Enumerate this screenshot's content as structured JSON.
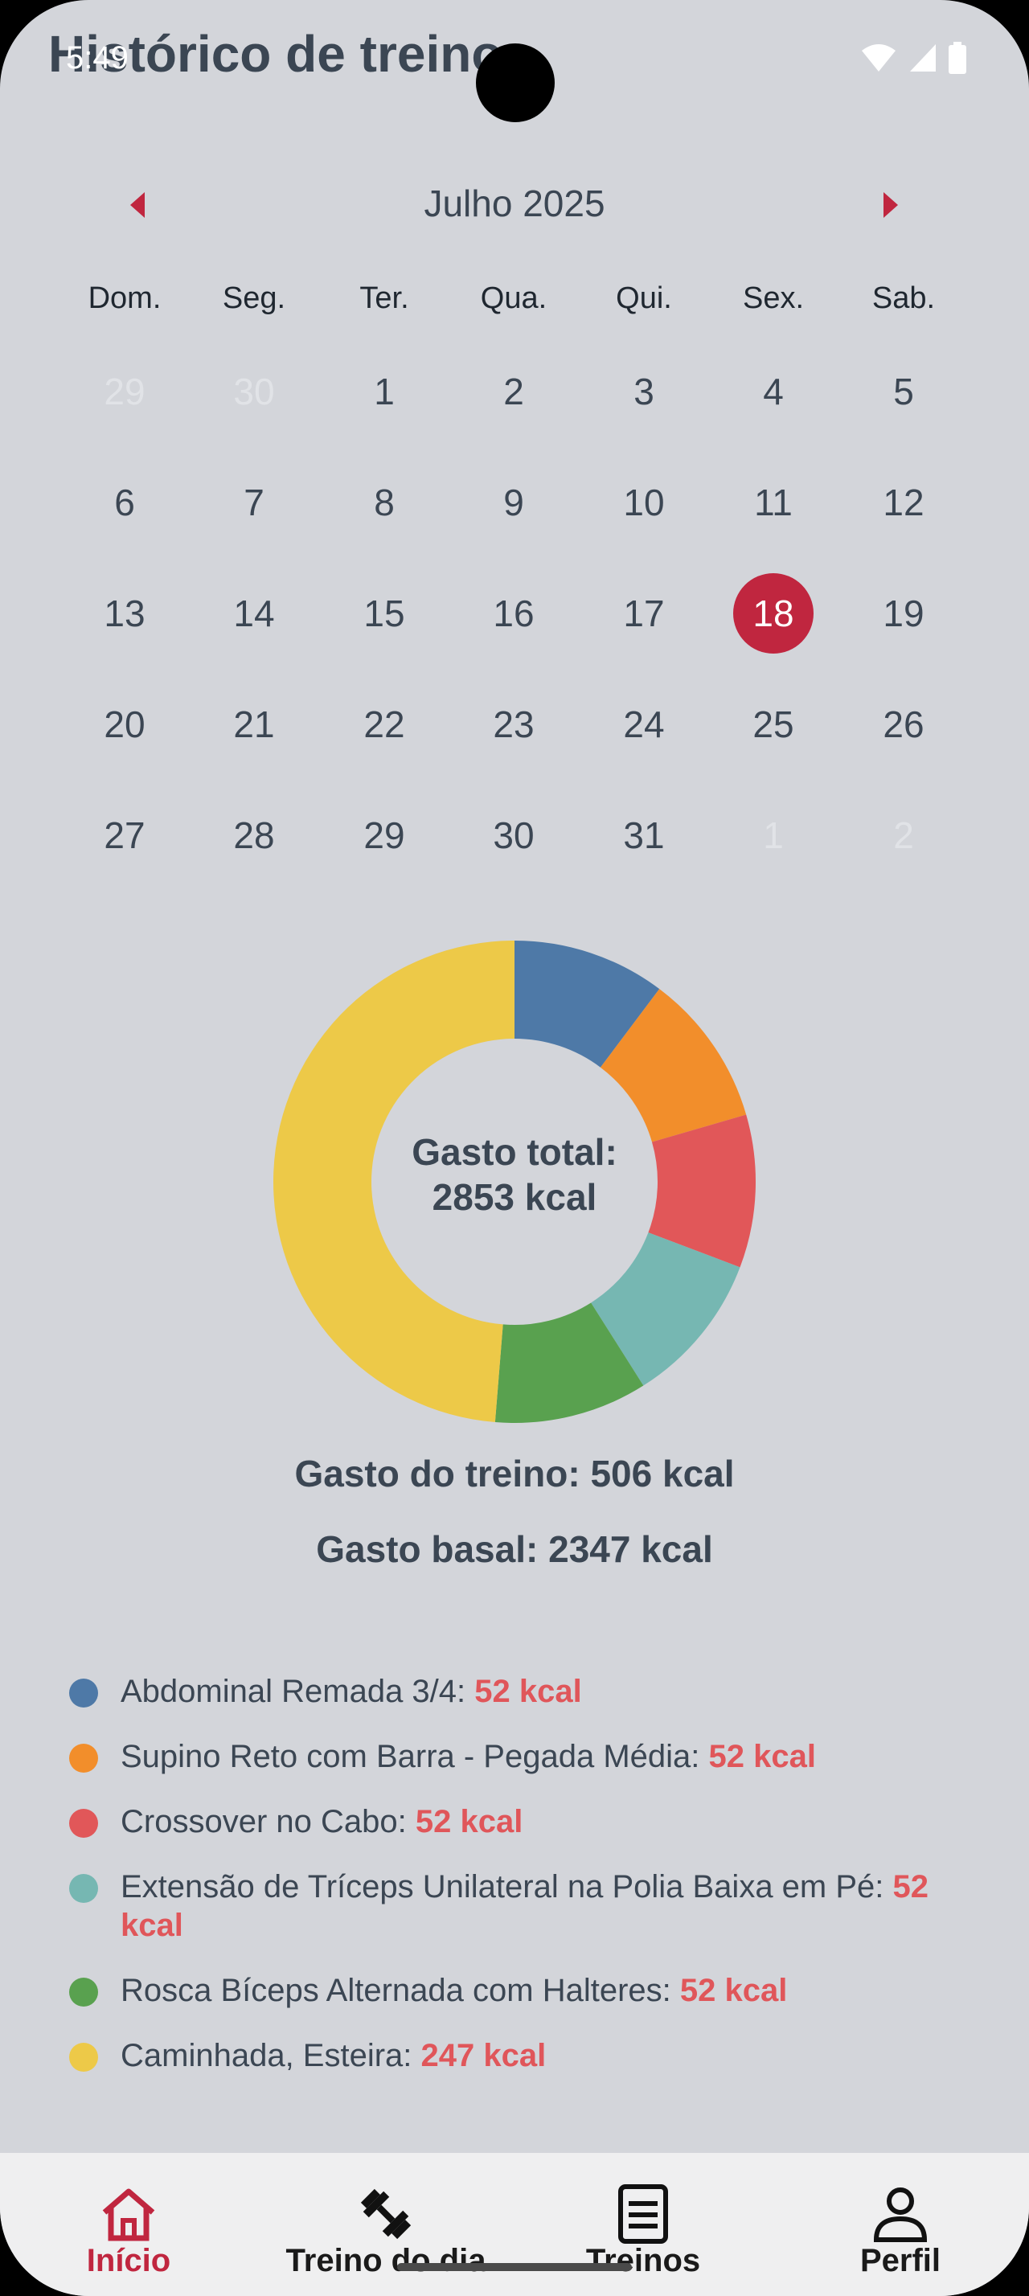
{
  "status_bar": {
    "time": "5:49",
    "icons": [
      "wifi-icon",
      "signal-icon",
      "battery-icon"
    ]
  },
  "header": {
    "title": "Histórico de treino"
  },
  "calendar": {
    "month_label": "Julho 2025",
    "prev_icon": "chevron-left-icon",
    "next_icon": "chevron-right-icon",
    "weekdays": [
      "Dom.",
      "Seg.",
      "Ter.",
      "Qua.",
      "Qui.",
      "Sex.",
      "Sab."
    ],
    "weeks": [
      [
        "29",
        "30",
        "1",
        "2",
        "3",
        "4",
        "5"
      ],
      [
        "6",
        "7",
        "8",
        "9",
        "10",
        "11",
        "12"
      ],
      [
        "13",
        "14",
        "15",
        "16",
        "17",
        "18",
        "19"
      ],
      [
        "20",
        "21",
        "22",
        "23",
        "24",
        "25",
        "26"
      ],
      [
        "27",
        "28",
        "29",
        "30",
        "31",
        "1",
        "2"
      ]
    ],
    "selected_day": "18",
    "accent_color": "#c0263f"
  },
  "chart_data": {
    "type": "pie",
    "title": "Gasto total: 2853 kcal",
    "categories": [
      "Abdominal Remada 3/4",
      "Supino Reto com Barra - Pegada Média",
      "Crossover no Cabo",
      "Extensão de Tríceps Unilateral na Polia Baixa em Pé",
      "Rosca Bíceps Alternada com Halteres",
      "Caminhada, Esteira"
    ],
    "values": [
      52,
      52,
      52,
      52,
      52,
      247
    ],
    "colors": [
      "#4e79a7",
      "#f28e2b",
      "#e15759",
      "#76b7b2",
      "#59a14f",
      "#edc948"
    ]
  },
  "summary": {
    "center_line1": "Gasto total:",
    "center_line2": "2853 kcal",
    "training": "Gasto do treino: 506 kcal",
    "basal": "Gasto basal: 2347 kcal"
  },
  "legend": [
    {
      "label": "Abdominal Remada 3/4: ",
      "value": "52 kcal",
      "color": "#4e79a7"
    },
    {
      "label": "Supino Reto com Barra - Pegada Média: ",
      "value": "52 kcal",
      "color": "#f28e2b"
    },
    {
      "label": "Crossover no Cabo: ",
      "value": "52 kcal",
      "color": "#e15759"
    },
    {
      "label": "Extensão de Tríceps Unilateral na Polia Baixa em Pé: ",
      "value": "52 kcal",
      "color": "#76b7b2"
    },
    {
      "label": "Rosca Bíceps Alternada com Halteres: ",
      "value": "52 kcal",
      "color": "#59a14f"
    },
    {
      "label": "Caminhada, Esteira: ",
      "value": "247 kcal",
      "color": "#edc948"
    }
  ],
  "bottom_nav": [
    {
      "label": "Início",
      "icon": "home-icon",
      "active": true
    },
    {
      "label": "Treino do dia",
      "icon": "dumbbell-icon",
      "active": false
    },
    {
      "label": "Treinos",
      "icon": "list-icon",
      "active": false
    },
    {
      "label": "Perfil",
      "icon": "person-icon",
      "active": false
    }
  ]
}
